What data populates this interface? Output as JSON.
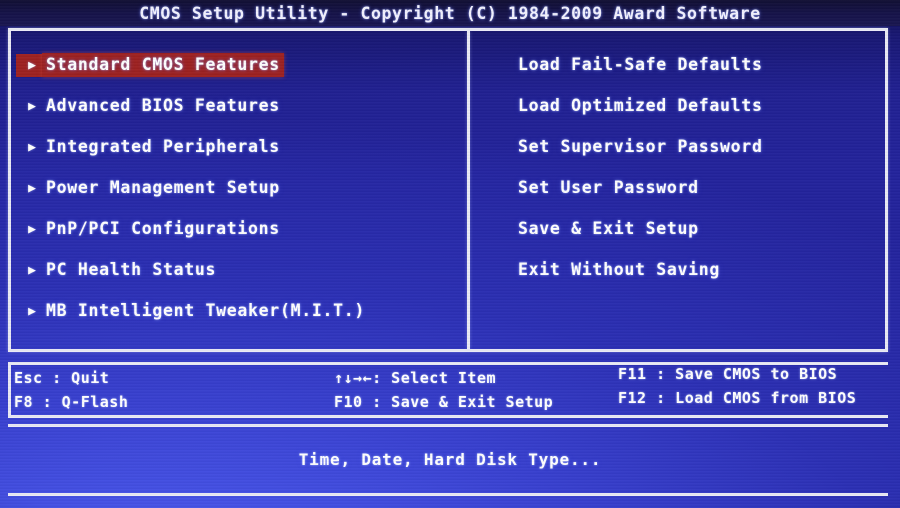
{
  "title": "CMOS Setup Utility - Copyright (C) 1984-2009 Award Software",
  "colors": {
    "background_blue": "#3840cf",
    "highlight_red": "#9e2221",
    "text_white": "#ffffff",
    "border_white": "#e9eaf6",
    "titlebar_navy": "#16134a"
  },
  "left_menu": {
    "items": [
      {
        "label": "Standard CMOS Features",
        "arrow": "▶",
        "selected": true
      },
      {
        "label": "Advanced BIOS Features",
        "arrow": "▶",
        "selected": false
      },
      {
        "label": "Integrated Peripherals",
        "arrow": "▶",
        "selected": false
      },
      {
        "label": "Power Management Setup",
        "arrow": "▶",
        "selected": false
      },
      {
        "label": "PnP/PCI Configurations",
        "arrow": "▶",
        "selected": false
      },
      {
        "label": "PC Health Status",
        "arrow": "▶",
        "selected": false
      },
      {
        "label": "MB Intelligent Tweaker(M.I.T.)",
        "arrow": "▶",
        "selected": false
      }
    ]
  },
  "right_menu": {
    "items": [
      {
        "label": "Load Fail-Safe Defaults",
        "selected": false
      },
      {
        "label": "Load Optimized Defaults",
        "selected": false
      },
      {
        "label": "Set Supervisor Password",
        "selected": false
      },
      {
        "label": "Set User Password",
        "selected": false
      },
      {
        "label": "Save & Exit Setup",
        "selected": false
      },
      {
        "label": "Exit Without Saving",
        "selected": false
      }
    ]
  },
  "help_bar": {
    "left": {
      "line1": "Esc : Quit",
      "line2": "F8  : Q-Flash"
    },
    "middle": {
      "line1": "↑↓→←: Select Item",
      "line2": "F10 : Save & Exit Setup"
    },
    "right": {
      "line1": "F11 : Save CMOS to BIOS",
      "line2": "F12 : Load CMOS from BIOS"
    }
  },
  "status": {
    "text": "Time, Date, Hard Disk Type..."
  }
}
